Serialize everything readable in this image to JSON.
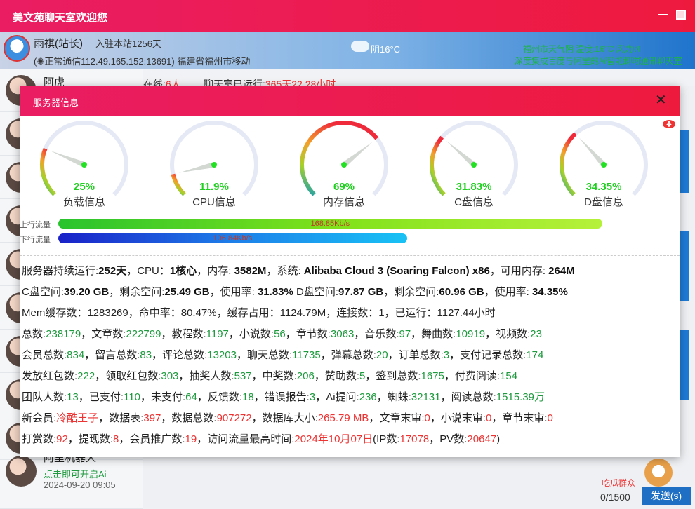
{
  "window": {
    "title": "美文苑聊天室欢迎您"
  },
  "userbar": {
    "name": "雨祺(站长)",
    "joined": "入驻本站1256天",
    "connection": "(✺正常通信112.49.165.152:13691) 福建省福州市移动",
    "weather_short": "阴16°C",
    "weather_line1": "福州市天气阴 温度:16°C 风力:4",
    "weather_line2": "深度集成百度与阿里的Ai智能即时通讯聊天室"
  },
  "chat": {
    "first_contact": "阿虎",
    "online_label": "在线:",
    "online_count": "6人",
    "uptime_label": "聊天室已运行:",
    "uptime_value": "365天22.28小时",
    "last_contact": {
      "name": "阿里机器人",
      "sub": "点击即可开启Ai",
      "time": "2024-09-20 09:05"
    },
    "char_count": "0/1500",
    "send_label": "发送(s)",
    "mascot_text": "吃瓜群众"
  },
  "modal": {
    "title": "服务器信息",
    "close": "✕",
    "gauges": [
      {
        "label": "负载信息",
        "pct": "25%",
        "value": 25
      },
      {
        "label": "CPU信息",
        "pct": "11.9%",
        "value": 11.9
      },
      {
        "label": "内存信息",
        "pct": "69%",
        "value": 69
      },
      {
        "label": "C盘信息",
        "pct": "31.83%",
        "value": 31.83
      },
      {
        "label": "D盘信息",
        "pct": "34.35%",
        "value": 34.35
      }
    ],
    "traffic": {
      "up_label": "上行流量",
      "up_value": "168.85Kb/s",
      "up_fraction": 0.92,
      "down_label": "下行流量",
      "down_value": "106.84Kb/s",
      "down_fraction": 0.59
    }
  },
  "info_lines": [
    [
      "服务器持续运行:",
      {
        "b": "252天"
      },
      "，CPU：",
      {
        "b": "1核心"
      },
      "，内存: ",
      {
        "b": "3582M"
      },
      "，系统: ",
      {
        "b": "Alibaba Cloud 3 (Soaring Falcon) x86"
      },
      "，可用内存: ",
      {
        "b": "264M"
      }
    ],
    [
      "C盘空间:",
      {
        "b": "39.20 GB"
      },
      "，剩余空间:",
      {
        "b": "25.49 GB"
      },
      "，使用率: ",
      {
        "b": "31.83%"
      },
      "      D盘空间:",
      {
        "b": "97.87 GB"
      },
      "，剩余空间:",
      {
        "b": "60.96 GB"
      },
      "，使用率: ",
      {
        "b": "34.35%"
      }
    ],
    [
      "Mem缓存数：1283269，命中率：80.47%，缓存占用：1124.79M，连接数：1，已运行：1127.44小时"
    ],
    [
      "总数:",
      {
        "g": "238179"
      },
      "，文章数:",
      {
        "g": "222799"
      },
      "，教程数:",
      {
        "g": "1197"
      },
      "，小说数:",
      {
        "g": "56"
      },
      "，章节数:",
      {
        "g": "3063"
      },
      "，音乐数:",
      {
        "g": "97"
      },
      "，舞曲数:",
      {
        "g": "10919"
      },
      "，视频数:",
      {
        "g": "23"
      }
    ],
    [
      "会员总数:",
      {
        "g": "834"
      },
      "，留言总数:",
      {
        "g": "83"
      },
      "，评论总数:",
      {
        "g": "13203"
      },
      "，聊天总数:",
      {
        "g": "11735"
      },
      "，弹幕总数:",
      {
        "g": "20"
      },
      "，订单总数:",
      {
        "g": "3"
      },
      "，支付记录总数:",
      {
        "g": "174"
      }
    ],
    [
      "发放红包数:",
      {
        "g": "222"
      },
      "，领取红包数:",
      {
        "g": "303"
      },
      "，抽奖人数:",
      {
        "g": "537"
      },
      "，中奖数:",
      {
        "g": "206"
      },
      "，赞助数:",
      {
        "g": "5"
      },
      "，签到总数:",
      {
        "g": "1675"
      },
      "，付费阅读:",
      {
        "g": "154"
      }
    ],
    [
      "团队人数:",
      {
        "g": "13"
      },
      "，已支付:",
      {
        "g": "110"
      },
      "，未支付:",
      {
        "g": "64"
      },
      "，反馈数:",
      {
        "g": "18"
      },
      "，错误报告:",
      {
        "g": "3"
      },
      "，Ai提问:",
      {
        "g": "236"
      },
      "，蜘蛛:",
      {
        "g": "32131"
      },
      "，阅读总数:",
      {
        "g": "1515.39万"
      }
    ],
    [
      "新会员:",
      {
        "r": "冷酷王子"
      },
      "，数据表:",
      {
        "r": "397"
      },
      "，数据总数:",
      {
        "r": "907272"
      },
      "，数据库大小:",
      {
        "r": "265.79 MB"
      },
      "，文章末审:",
      {
        "r": "0"
      },
      "，小说末审:",
      {
        "r": "0"
      },
      "，章节末审:",
      {
        "r": "0"
      }
    ],
    [
      "打赏数:",
      {
        "r": "92"
      },
      "，提现数:",
      {
        "r": "8"
      },
      "，会员推广数:",
      {
        "r": "19"
      },
      "，访问流量最高时间:",
      {
        "r": "2024年10月07日"
      },
      "(IP数:",
      {
        "r": "17078"
      },
      "，PV数:",
      {
        "r": "20647"
      },
      ")"
    ]
  ]
}
